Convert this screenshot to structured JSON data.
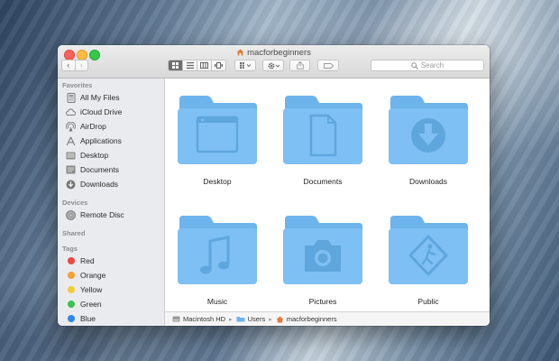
{
  "window": {
    "title": "macforbeginners"
  },
  "toolbar": {
    "back_label": "‹",
    "forward_label": "›",
    "search_placeholder": "Search"
  },
  "sidebar": {
    "favorites_header": "Favorites",
    "favorites": [
      {
        "label": "All My Files",
        "icon": "all-my-files-icon"
      },
      {
        "label": "iCloud Drive",
        "icon": "cloud-icon"
      },
      {
        "label": "AirDrop",
        "icon": "airdrop-icon"
      },
      {
        "label": "Applications",
        "icon": "applications-icon"
      },
      {
        "label": "Desktop",
        "icon": "desktop-icon"
      },
      {
        "label": "Documents",
        "icon": "documents-icon"
      },
      {
        "label": "Downloads",
        "icon": "downloads-icon"
      }
    ],
    "devices_header": "Devices",
    "devices": [
      {
        "label": "Remote Disc",
        "icon": "disc-icon"
      }
    ],
    "shared_header": "Shared",
    "tags_header": "Tags",
    "tags": [
      {
        "label": "Red",
        "color": "#f0473f"
      },
      {
        "label": "Orange",
        "color": "#f6a035"
      },
      {
        "label": "Yellow",
        "color": "#f2cb38"
      },
      {
        "label": "Green",
        "color": "#3fc24d"
      },
      {
        "label": "Blue",
        "color": "#2f86ea"
      }
    ]
  },
  "folders": [
    {
      "label": "Desktop",
      "icon": "desktop-folder-icon"
    },
    {
      "label": "Documents",
      "icon": "document-folder-icon"
    },
    {
      "label": "Downloads",
      "icon": "download-folder-icon"
    },
    {
      "label": "Music",
      "icon": "music-folder-icon"
    },
    {
      "label": "Pictures",
      "icon": "camera-folder-icon"
    },
    {
      "label": "Public",
      "icon": "public-folder-icon"
    }
  ],
  "pathbar": {
    "segments": [
      "Macintosh HD",
      "Users",
      "macforbeginners"
    ]
  },
  "colors": {
    "folder_fill": "#7ec0f3",
    "folder_tab": "#6eb4ec",
    "folder_glyph": "#5fa6dd",
    "sidebar_bg": "#e9ebee"
  }
}
